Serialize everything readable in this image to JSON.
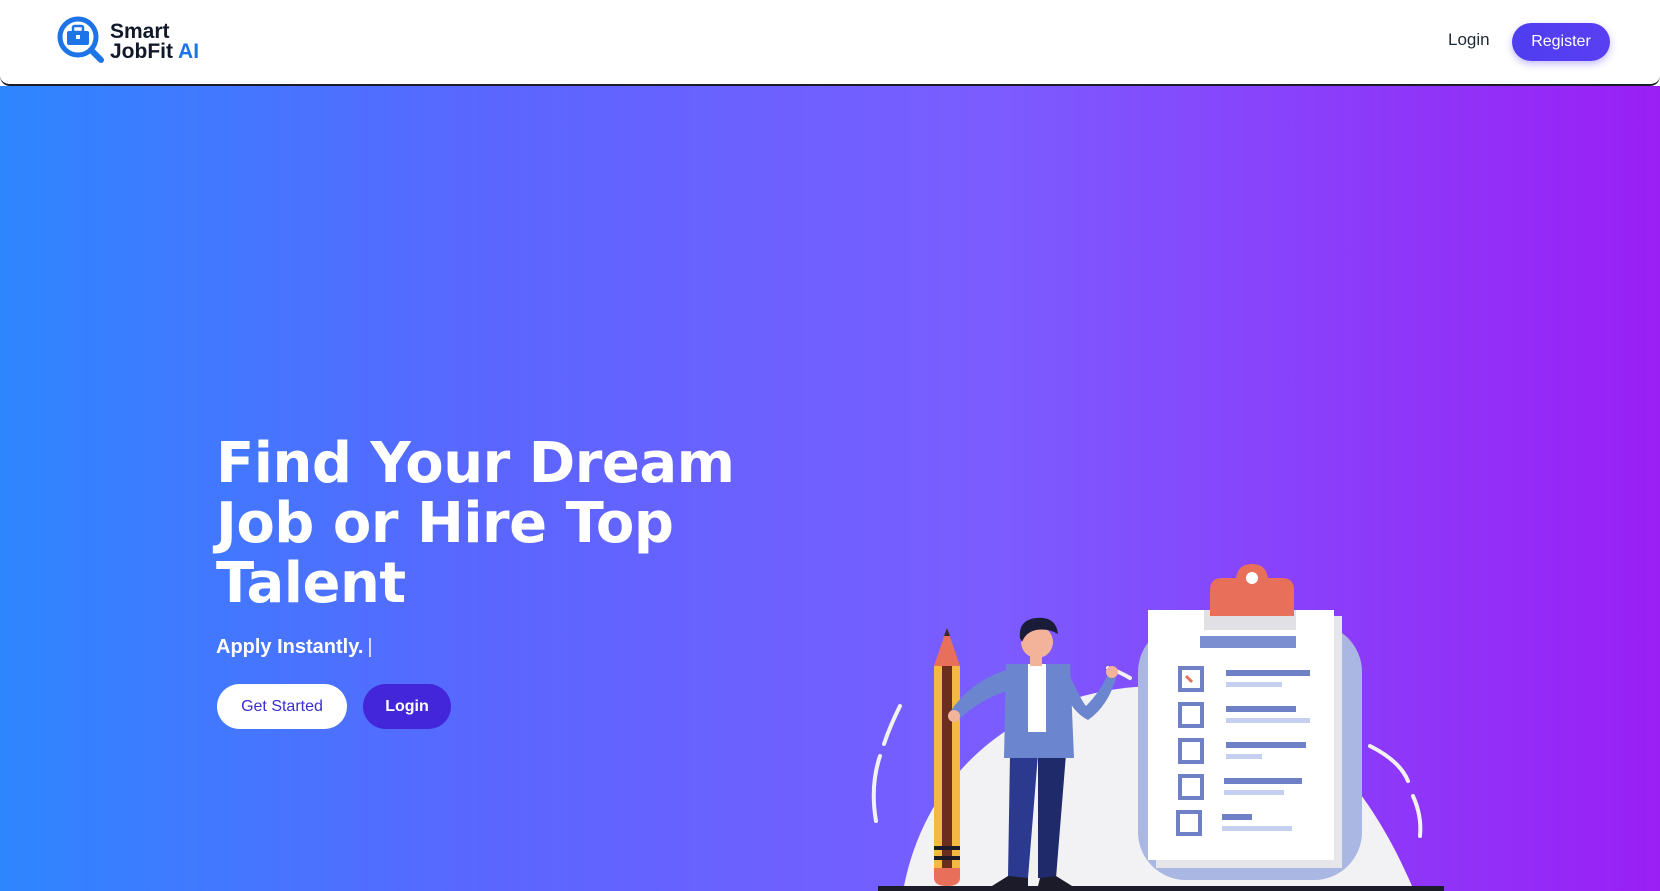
{
  "brand": {
    "line1": "Smart",
    "line2_main": "JobFit ",
    "line2_accent": "AI",
    "icon": "briefcase-search-icon"
  },
  "nav": {
    "login_label": "Login",
    "register_label": "Register"
  },
  "hero": {
    "headline": "Find Your Dream Job or Hire Top Talent",
    "subline": "Apply Instantly.",
    "caret": "|",
    "get_started_label": "Get Started",
    "login_label": "Login",
    "illustration": "person-with-pencil-and-checklist-clipboard"
  },
  "colors": {
    "accent": "#4f3df0",
    "hero_gradient_start": "#2e86ff",
    "hero_gradient_end": "#9a1ff5",
    "brand_ai": "#1d74e8"
  }
}
